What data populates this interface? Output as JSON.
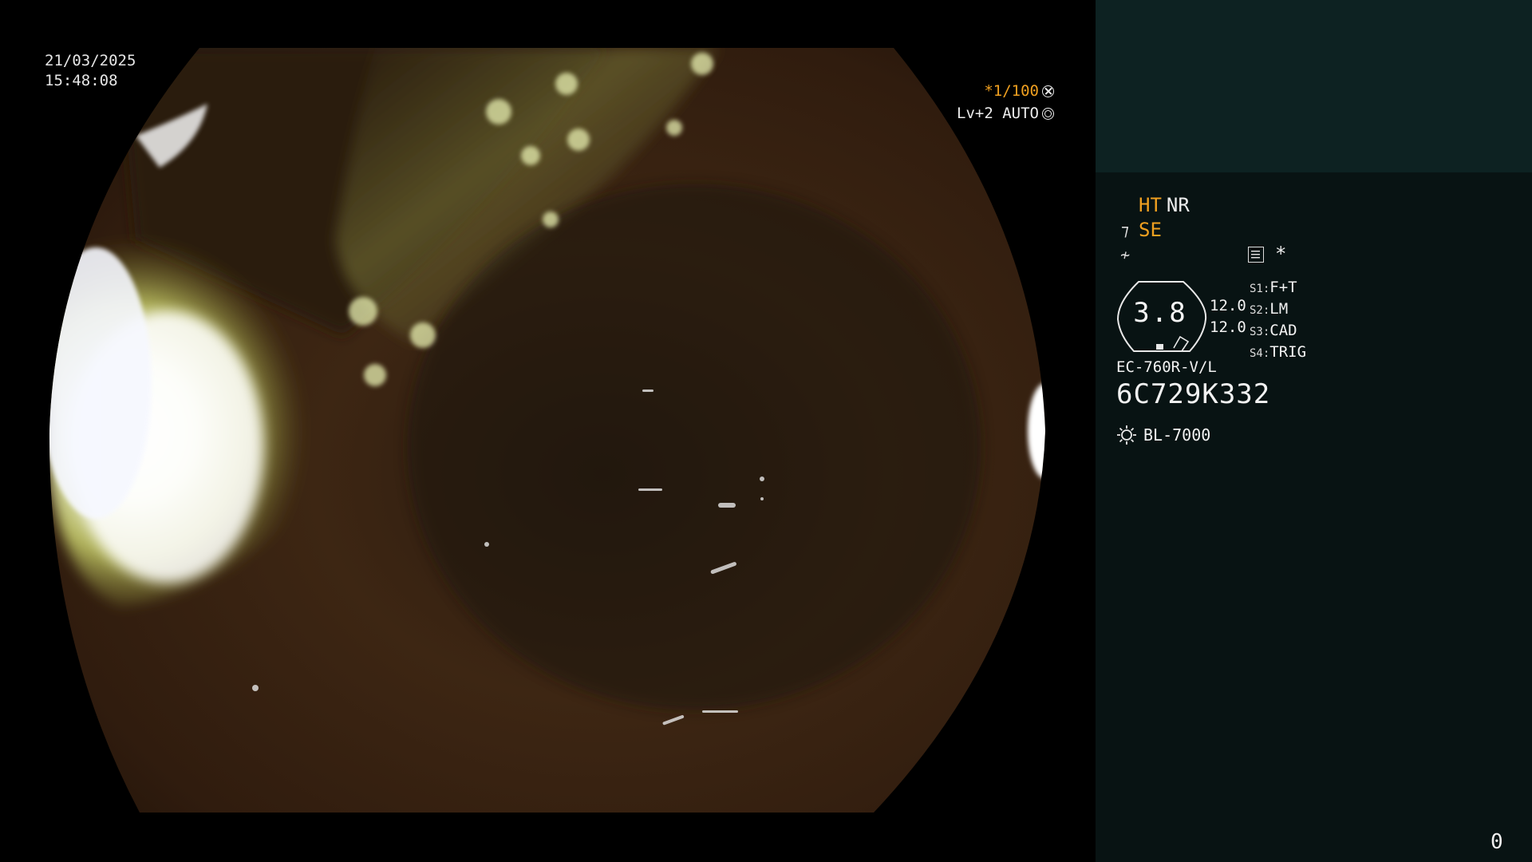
{
  "window": {
    "width": 1920,
    "height": 1080
  },
  "overlay": {
    "date": "21/03/2025",
    "time": "15:48:08",
    "shutter_speed": "*1/100",
    "exposure_mode": "Lv+2 AUTO",
    "shutter_icon": "shutter-icon",
    "iris_icon": "iris-icon"
  },
  "panel": {
    "mode_ht": "HT",
    "mode_nr": "NR",
    "mode_se": "SE",
    "se_glyph": "⁊",
    "fn_glyph": "≁",
    "memo_icon": "memo-icon",
    "asterisk": "*",
    "gauge_value": "3.8",
    "gauge_right_1": "12.0",
    "gauge_right_2": "12.0",
    "switches": [
      {
        "key": "S1:",
        "value": "F+T"
      },
      {
        "key": "S2:",
        "value": "LM"
      },
      {
        "key": "S3:",
        "value": "CAD"
      },
      {
        "key": "S4:",
        "value": "TRIG"
      }
    ],
    "scope_model": "EC-760R-V/L",
    "scope_serial": "6C729K332",
    "light_source": "BL-7000",
    "light_icon": "sun-icon",
    "counter": "0"
  },
  "colors": {
    "accent_orange": "#f0a020",
    "panel_bg": "#081313",
    "panel_top_bg": "#0d2222",
    "text": "#ececec"
  }
}
